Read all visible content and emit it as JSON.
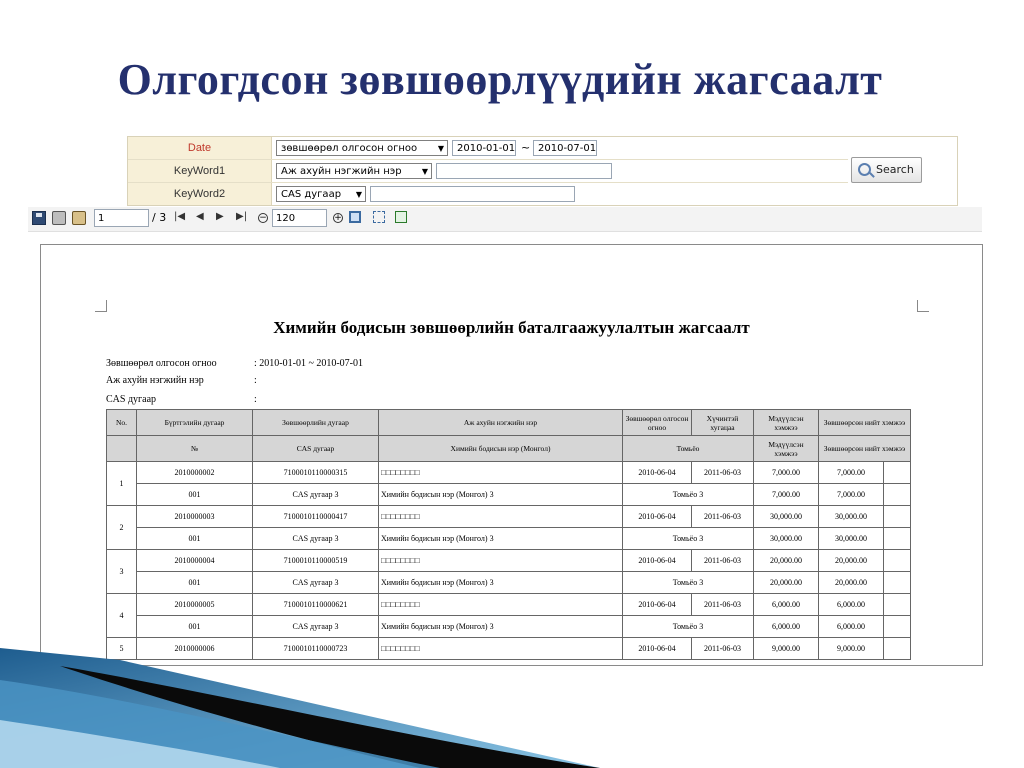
{
  "title": "Олгогдсон зөвшөөрлүүдийн жагсаалт",
  "search_form": {
    "date_label": "Date",
    "date_type": "зөвшөөрөл олгосон огноо",
    "date_from": "2010-01-01",
    "date_sep": "~",
    "date_to": "2010-07-01",
    "keyword1_label": "KeyWord1",
    "keyword1_select": "Аж ахуйн нэгжийн нэр",
    "keyword1_value": "",
    "keyword2_label": "KeyWord2",
    "keyword2_select": "CAS дугаар",
    "keyword2_value": "",
    "search_button": "Search"
  },
  "toolbar": {
    "page_input": "1",
    "page_total": "/ 3",
    "zoom": "120",
    "icons": [
      "save-icon",
      "print-icon",
      "print-settings-icon",
      "first-page-icon",
      "prev-page-icon",
      "next-page-icon",
      "last-page-icon",
      "zoom-out-icon",
      "zoom-in-icon",
      "fit-page-icon",
      "fit-width-icon",
      "refresh-icon"
    ]
  },
  "report": {
    "title": "Химийн бодисын зөвшөөрлийн баталгаажуулалтын жагсаалт",
    "criteria": [
      {
        "label": "Зөвшөөрөл олгосон огноо",
        "value": ": 2010-01-01 ~ 2010-07-01"
      },
      {
        "label": "Аж ахуйн нэгжийн нэр",
        "value": ":"
      },
      {
        "label": "CAS дугаар",
        "value": ":"
      }
    ],
    "headers_row1": [
      "No.",
      "Бүртгэлийн дугаар",
      "Зөвшөөрлийн дугаар",
      "Аж ахуйн нэгжийн нэр",
      "Зөвшөөрөл олгосон огноо",
      "Хүчинтэй хугацаа",
      "Мэдүүлсэн хэмжээ",
      "Зөвшөөрсөн нийт хэмжээ"
    ],
    "headers_row2": [
      "№",
      "CAS дугаар",
      "Химийн бодисын нэр (Монгол)",
      "Томьёо",
      "Мэдүүлсэн хэмжээ",
      "Зөвшөөрсөн нийт хэмжээ"
    ],
    "rows": [
      {
        "no": "1",
        "reg": "2010000002",
        "permit": "7100010110000315",
        "company": "□□□□□□□□",
        "issued": "2010-06-04",
        "valid": "2011-06-03",
        "declared": "7,000.00",
        "approved": "7,000.00",
        "sub_no": "001",
        "cas": "CAS дугаар 3",
        "chem": "Химийн бодисын нэр (Монгол) 3",
        "formula": "Томьёо 3",
        "sub_declared": "7,000.00",
        "sub_approved": "7,000.00"
      },
      {
        "no": "2",
        "reg": "2010000003",
        "permit": "7100010110000417",
        "company": "□□□□□□□□",
        "issued": "2010-06-04",
        "valid": "2011-06-03",
        "declared": "30,000.00",
        "approved": "30,000.00",
        "sub_no": "001",
        "cas": "CAS дугаар 3",
        "chem": "Химийн бодисын нэр (Монгол) 3",
        "formula": "Томьёо 3",
        "sub_declared": "30,000.00",
        "sub_approved": "30,000.00"
      },
      {
        "no": "3",
        "reg": "2010000004",
        "permit": "7100010110000519",
        "company": "□□□□□□□□",
        "issued": "2010-06-04",
        "valid": "2011-06-03",
        "declared": "20,000.00",
        "approved": "20,000.00",
        "sub_no": "001",
        "cas": "CAS дугаар 3",
        "chem": "Химийн бодисын нэр (Монгол) 3",
        "formula": "Томьёо 3",
        "sub_declared": "20,000.00",
        "sub_approved": "20,000.00"
      },
      {
        "no": "4",
        "reg": "2010000005",
        "permit": "7100010110000621",
        "company": "□□□□□□□□",
        "issued": "2010-06-04",
        "valid": "2011-06-03",
        "declared": "6,000.00",
        "approved": "6,000.00",
        "sub_no": "001",
        "cas": "CAS дугаар 3",
        "chem": "Химийн бодисын нэр (Монгол) 3",
        "formula": "Томьёо 3",
        "sub_declared": "6,000.00",
        "sub_approved": "6,000.00"
      },
      {
        "no": "5",
        "reg": "2010000006",
        "permit": "7100010110000723",
        "company": "□□□□□□□□",
        "issued": "2010-06-04",
        "valid": "2011-06-03",
        "declared": "9,000.00",
        "approved": "9,000.00"
      }
    ]
  }
}
